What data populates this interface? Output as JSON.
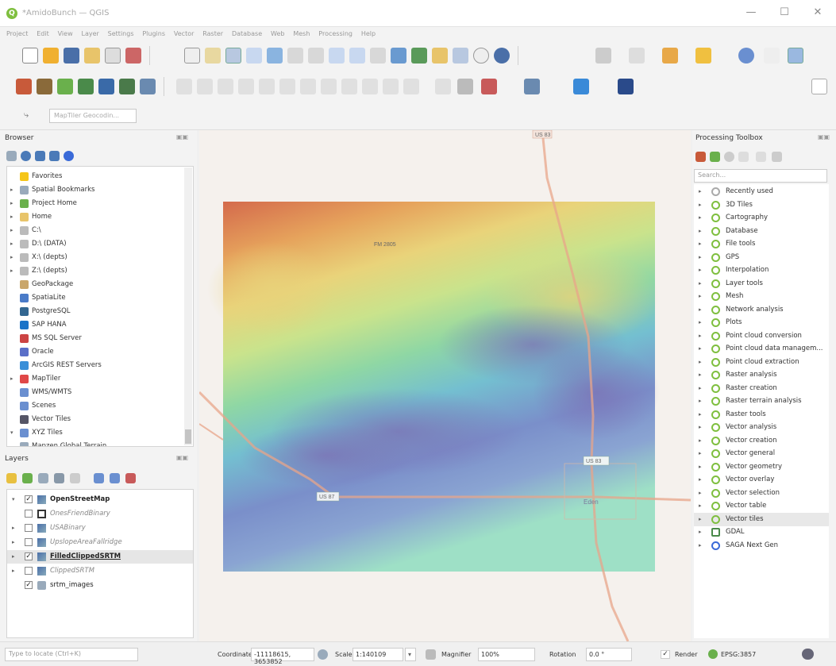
{
  "window": {
    "title": "*AmidoBunch — QGIS",
    "controls": [
      "—",
      "☐",
      "✕"
    ]
  },
  "menu": [
    "Project",
    "Edit",
    "View",
    "Layer",
    "Settings",
    "Plugins",
    "Vector",
    "Raster",
    "Database",
    "Web",
    "Mesh",
    "Processing",
    "Help"
  ],
  "geocoder": {
    "placeholder": "MapTiler Geocodin..."
  },
  "browser": {
    "title": "Browser",
    "items": [
      {
        "label": "Favorites",
        "icon": "star-icon",
        "color": "#f5c518",
        "arrow": ""
      },
      {
        "label": "Spatial Bookmarks",
        "icon": "bookmark-icon",
        "color": "#9ab",
        "arrow": "▸"
      },
      {
        "label": "Project Home",
        "icon": "folder-icon",
        "color": "#6ab04c",
        "arrow": "▸"
      },
      {
        "label": "Home",
        "icon": "folder-icon",
        "color": "#e8c46a",
        "arrow": "▸"
      },
      {
        "label": "C:\\",
        "icon": "drive-icon",
        "color": "#bbb",
        "arrow": "▸"
      },
      {
        "label": "D:\\ (DATA)",
        "icon": "drive-icon",
        "color": "#bbb",
        "arrow": "▸"
      },
      {
        "label": "X:\\ (depts)",
        "icon": "drive-icon",
        "color": "#bbb",
        "arrow": "▸"
      },
      {
        "label": "Z:\\ (depts)",
        "icon": "drive-icon",
        "color": "#bbb",
        "arrow": "▸"
      },
      {
        "label": "GeoPackage",
        "icon": "geopackage-icon",
        "color": "#c9a66b",
        "arrow": ""
      },
      {
        "label": "SpatiaLite",
        "icon": "spatialite-icon",
        "color": "#4a7bc8",
        "arrow": ""
      },
      {
        "label": "PostgreSQL",
        "icon": "postgresql-icon",
        "color": "#336791",
        "arrow": ""
      },
      {
        "label": "SAP HANA",
        "icon": "sap-hana-icon",
        "color": "#1a73c8",
        "arrow": ""
      },
      {
        "label": "MS SQL Server",
        "icon": "mssql-icon",
        "color": "#c44",
        "arrow": ""
      },
      {
        "label": "Oracle",
        "icon": "oracle-icon",
        "color": "#5a6fc8",
        "arrow": ""
      },
      {
        "label": "ArcGIS REST Servers",
        "icon": "arcgis-icon",
        "color": "#3a8fd8",
        "arrow": ""
      },
      {
        "label": "MapTiler",
        "icon": "maptiler-icon",
        "color": "#e04848",
        "arrow": "▸"
      },
      {
        "label": "WMS/WMTS",
        "icon": "wms-icon",
        "color": "#6a8fd0",
        "arrow": ""
      },
      {
        "label": "Scenes",
        "icon": "scenes-icon",
        "color": "#6a8fd0",
        "arrow": ""
      },
      {
        "label": "Vector Tiles",
        "icon": "vector-tiles-icon",
        "color": "#556",
        "arrow": ""
      },
      {
        "label": "XYZ Tiles",
        "icon": "xyz-tiles-icon",
        "color": "#6a8fd0",
        "arrow": "▾"
      },
      {
        "label": "Mapzen Global Terrain",
        "icon": "tile-icon",
        "color": "#9ab",
        "arrow": ""
      }
    ]
  },
  "layers": {
    "title": "Layers",
    "items": [
      {
        "label": "OpenStreetMap",
        "checked": true,
        "bold": true,
        "italic": false,
        "underline": false,
        "arrow": "▾",
        "icon": "raster-icon"
      },
      {
        "label": "OnesFriendBinary",
        "checked": false,
        "bold": false,
        "italic": true,
        "underline": false,
        "arrow": "",
        "icon": "polygon-icon"
      },
      {
        "label": "USABinary",
        "checked": false,
        "bold": false,
        "italic": true,
        "underline": false,
        "arrow": "▸",
        "icon": "raster-icon"
      },
      {
        "label": "UpslopeAreaFallridge",
        "checked": false,
        "bold": false,
        "italic": true,
        "underline": false,
        "arrow": "▸",
        "icon": "raster-icon"
      },
      {
        "label": "FilledClippedSRTM",
        "checked": true,
        "bold": true,
        "italic": false,
        "underline": true,
        "arrow": "▸",
        "icon": "raster-icon"
      },
      {
        "label": "ClippedSRTM",
        "checked": false,
        "bold": false,
        "italic": true,
        "underline": false,
        "arrow": "▸",
        "icon": "raster-icon"
      },
      {
        "label": "srtm_images",
        "checked": true,
        "bold": false,
        "italic": false,
        "underline": false,
        "arrow": "",
        "icon": "group-icon"
      }
    ]
  },
  "map": {
    "labels": [
      "US 83",
      "FM 2805",
      "US 83",
      "US 87",
      "Eden"
    ],
    "colors": {
      "background": "#f5f1ed",
      "road": "#e8a58a",
      "high": "#d96a4a",
      "low": "#7c6fb4"
    }
  },
  "toolbox": {
    "title": "Processing Toolbox",
    "search_placeholder": "Search...",
    "items": [
      "Recently used",
      "3D Tiles",
      "Cartography",
      "Database",
      "File tools",
      "GPS",
      "Interpolation",
      "Layer tools",
      "Mesh",
      "Network analysis",
      "Plots",
      "Point cloud conversion",
      "Point cloud data managem...",
      "Point cloud extraction",
      "Raster analysis",
      "Raster creation",
      "Raster terrain analysis",
      "Raster tools",
      "Vector analysis",
      "Vector creation",
      "Vector general",
      "Vector geometry",
      "Vector overlay",
      "Vector selection",
      "Vector table",
      "Vector tiles",
      "GDAL",
      "SAGA Next Gen"
    ],
    "selected_index": 25
  },
  "status": {
    "locator_placeholder": "Type to locate (Ctrl+K)",
    "coordinate_label": "Coordinate",
    "coordinate_value": "-11118615, 3653852",
    "scale_label": "Scale",
    "scale_value": "1:140109",
    "magnifier_label": "Magnifier",
    "magnifier_value": "100%",
    "rotation_label": "Rotation",
    "rotation_value": "0.0 °",
    "render_label": "Render",
    "crs": "EPSG:3857"
  }
}
